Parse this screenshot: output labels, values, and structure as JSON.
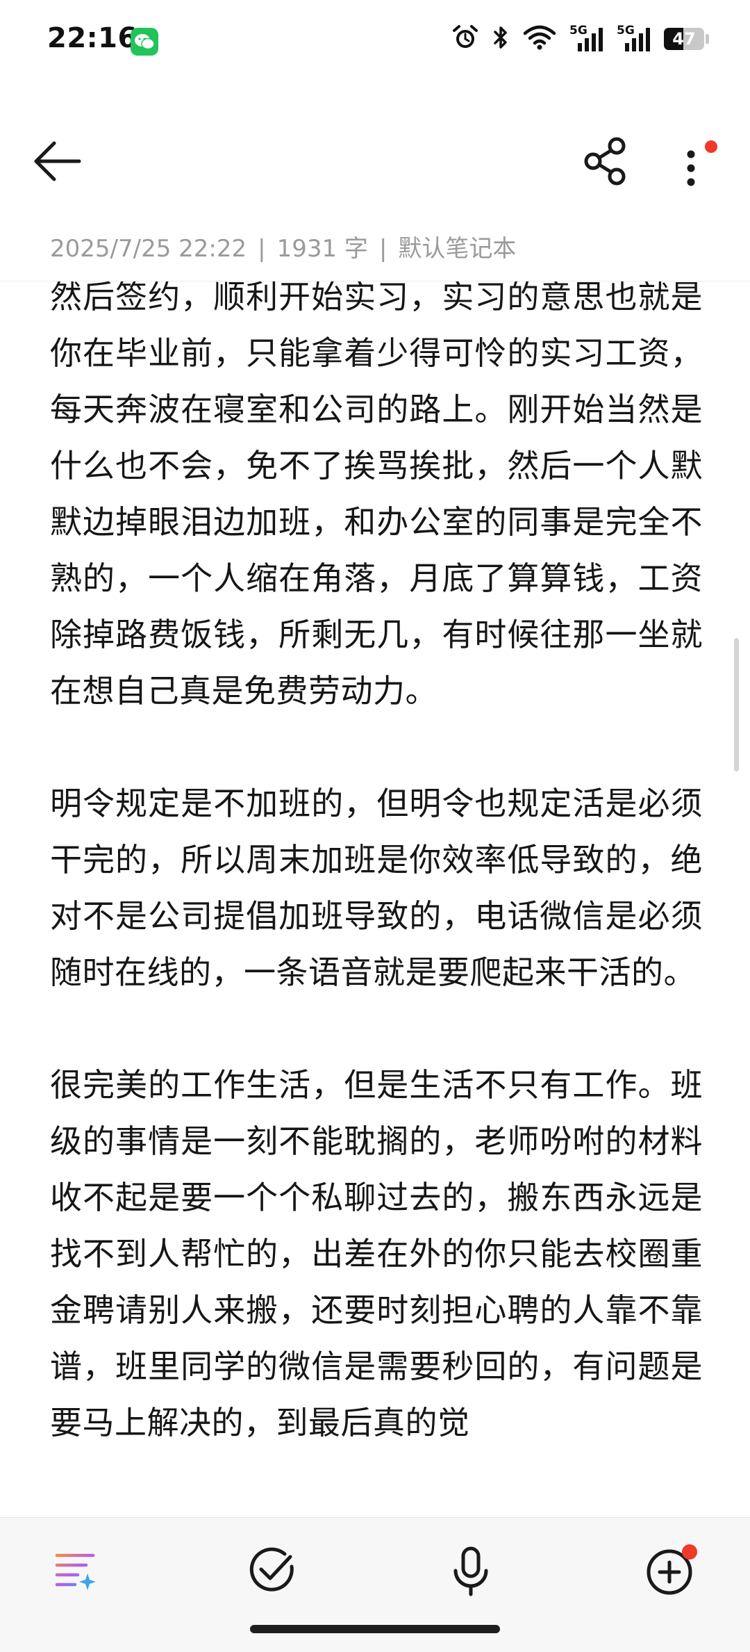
{
  "status_bar": {
    "time": "22:16",
    "battery": "47",
    "network_1": "5G",
    "network_2": "5G",
    "icons": [
      "wechat-icon",
      "alarm-icon",
      "bluetooth-icon",
      "wifi-icon",
      "signal-icon",
      "signal-icon",
      "battery-icon"
    ]
  },
  "app_bar": {
    "icons": [
      "back-arrow-icon",
      "share-icon",
      "more-vertical-icon"
    ],
    "has_notification_dot": true
  },
  "note": {
    "date": "2025/7/25 22:22",
    "word_count": "1931 字",
    "notebook": "默认笔记本",
    "separator": "|",
    "paragraphs": [
      "然后签约，顺利开始实习，实习的意思也就是你在毕业前，只能拿着少得可怜的实习工资，每天奔波在寝室和公司的路上。刚开始当然是什么也不会，免不了挨骂挨批，然后一个人默默边掉眼泪边加班，和办公室的同事是完全不熟的，一个人缩在角落，月底了算算钱，工资除掉路费饭钱，所剩无几，有时候往那一坐就在想自己真是免费劳动力。",
      "明令规定是不加班的，但明令也规定活是必须干完的，所以周末加班是你效率低导致的，绝对不是公司提倡加班导致的，电话微信是必须随时在线的，一条语音就是要爬起来干活的。",
      "很完美的工作生活，但是生活不只有工作。班级的事情是一刻不能耽搁的，老师吩咐的材料收不起是要一个个私聊过去的，搬东西永远是找不到人帮忙的，出差在外的你只能去校圈重金聘请别人来搬，还要时刻担心聘的人靠不靠谱，班里同学的微信是需要秒回的，有问题是要马上解决的，到最后真的觉"
    ]
  },
  "toolbar": {
    "icons": [
      "ai-format-icon",
      "checklist-icon",
      "microphone-icon",
      "add-icon"
    ]
  },
  "colors": {
    "accent_red": "#f0392b",
    "wechat_green": "#21c45a",
    "meta_gray": "#9a9a9a"
  }
}
